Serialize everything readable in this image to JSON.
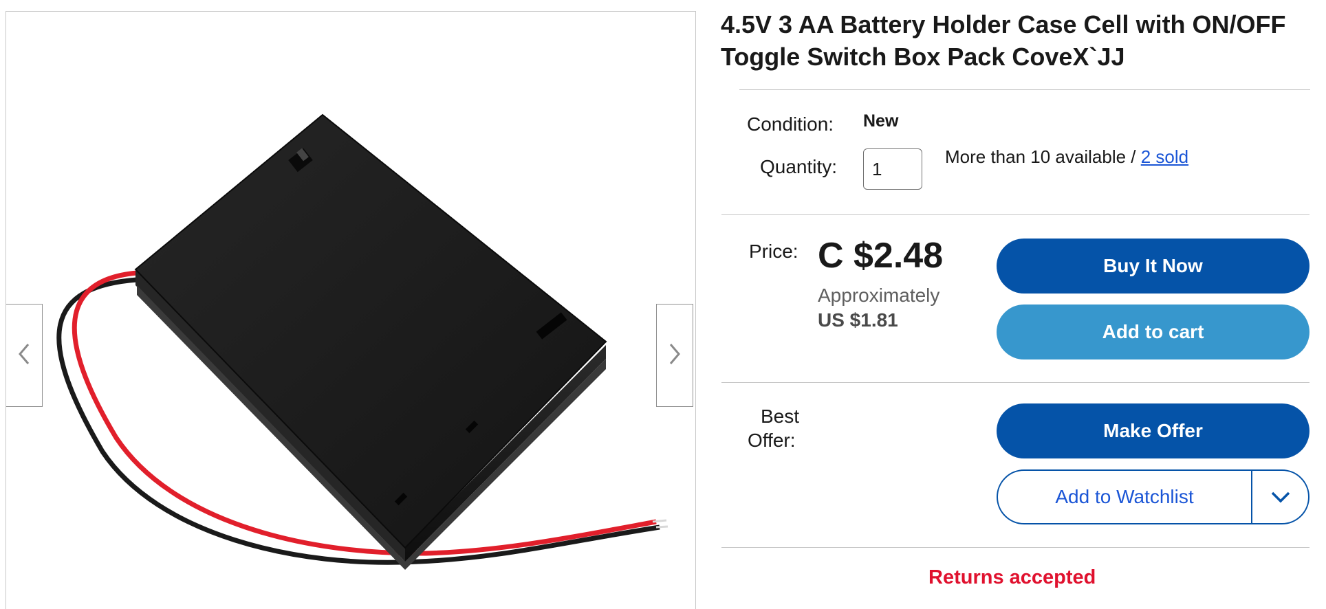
{
  "gallery": {
    "image_alt": "Black 3 AA battery holder box with switch and red/black wires",
    "prev_icon": "chevron-left-icon",
    "next_icon": "chevron-right-icon"
  },
  "listing": {
    "title": "4.5V 3 AA Battery Holder Case Cell with ON/OFF Toggle Switch Box Pack CoveX`JJ"
  },
  "details": {
    "condition_label": "Condition:",
    "condition_value": "New",
    "quantity_label": "Quantity:",
    "quantity_value": "1",
    "availability_text": "More than 10 available / ",
    "sold_link": "2 sold"
  },
  "price": {
    "label": "Price:",
    "value": "C $2.48",
    "approx_label": "Approximately",
    "approx_value": "US $1.81"
  },
  "actions": {
    "buy_now": "Buy It Now",
    "add_to_cart": "Add to cart",
    "best_offer_label_1": "Best",
    "best_offer_label_2": "Offer:",
    "make_offer": "Make Offer",
    "add_to_watchlist": "Add to Watchlist",
    "watchlist_dropdown_icon": "chevron-down-icon"
  },
  "returns": {
    "text": "Returns accepted"
  },
  "colors": {
    "primary_button": "#0553a8",
    "secondary_button": "#3797cd",
    "link": "#1a55d6",
    "returns": "#e0112e"
  }
}
